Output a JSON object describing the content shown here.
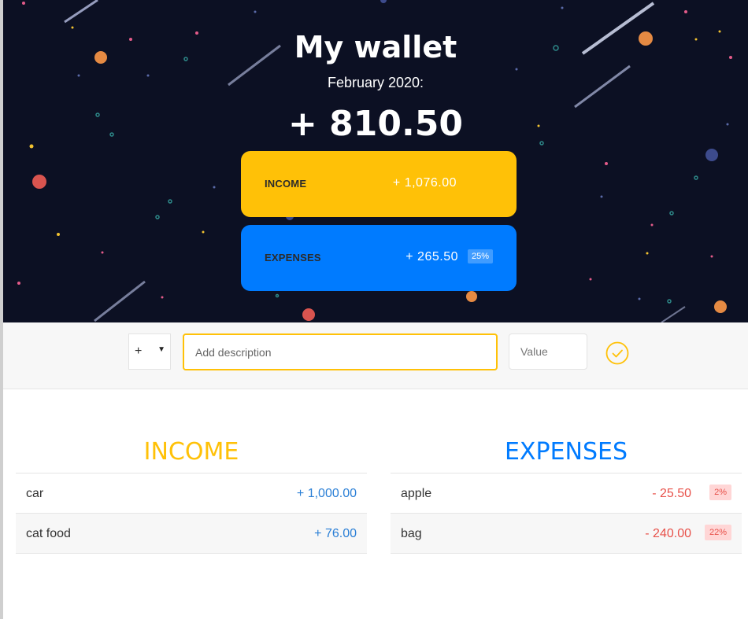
{
  "header": {
    "title": "My wallet",
    "month": "February 2020:",
    "balance": "+ 810.50"
  },
  "summary": {
    "income": {
      "label": "INCOME",
      "value": "+ 1,076.00"
    },
    "expenses": {
      "label": "EXPENSES",
      "value": "+ 265.50",
      "percentage": "25%"
    }
  },
  "add_bar": {
    "type_value": "+",
    "description_placeholder": "Add description",
    "value_placeholder": "Value"
  },
  "income": {
    "title": "INCOME",
    "items": [
      {
        "description": "car",
        "value": "+ 1,000.00"
      },
      {
        "description": "cat food",
        "value": "+ 76.00"
      }
    ]
  },
  "expenses": {
    "title": "EXPENSES",
    "items": [
      {
        "description": "apple",
        "value": "- 25.50",
        "percentage": "2%"
      },
      {
        "description": "bag",
        "value": "- 240.00",
        "percentage": "22%"
      }
    ]
  },
  "colors": {
    "income_accent": "#ffc107",
    "expenses_accent": "#007bff",
    "income_value": "#2a7fd6",
    "expense_value": "#e8514a",
    "hero_background": "#0c1023"
  },
  "icons": {
    "confirm": "check-circle-icon",
    "type_caret": "caret-down-icon"
  }
}
